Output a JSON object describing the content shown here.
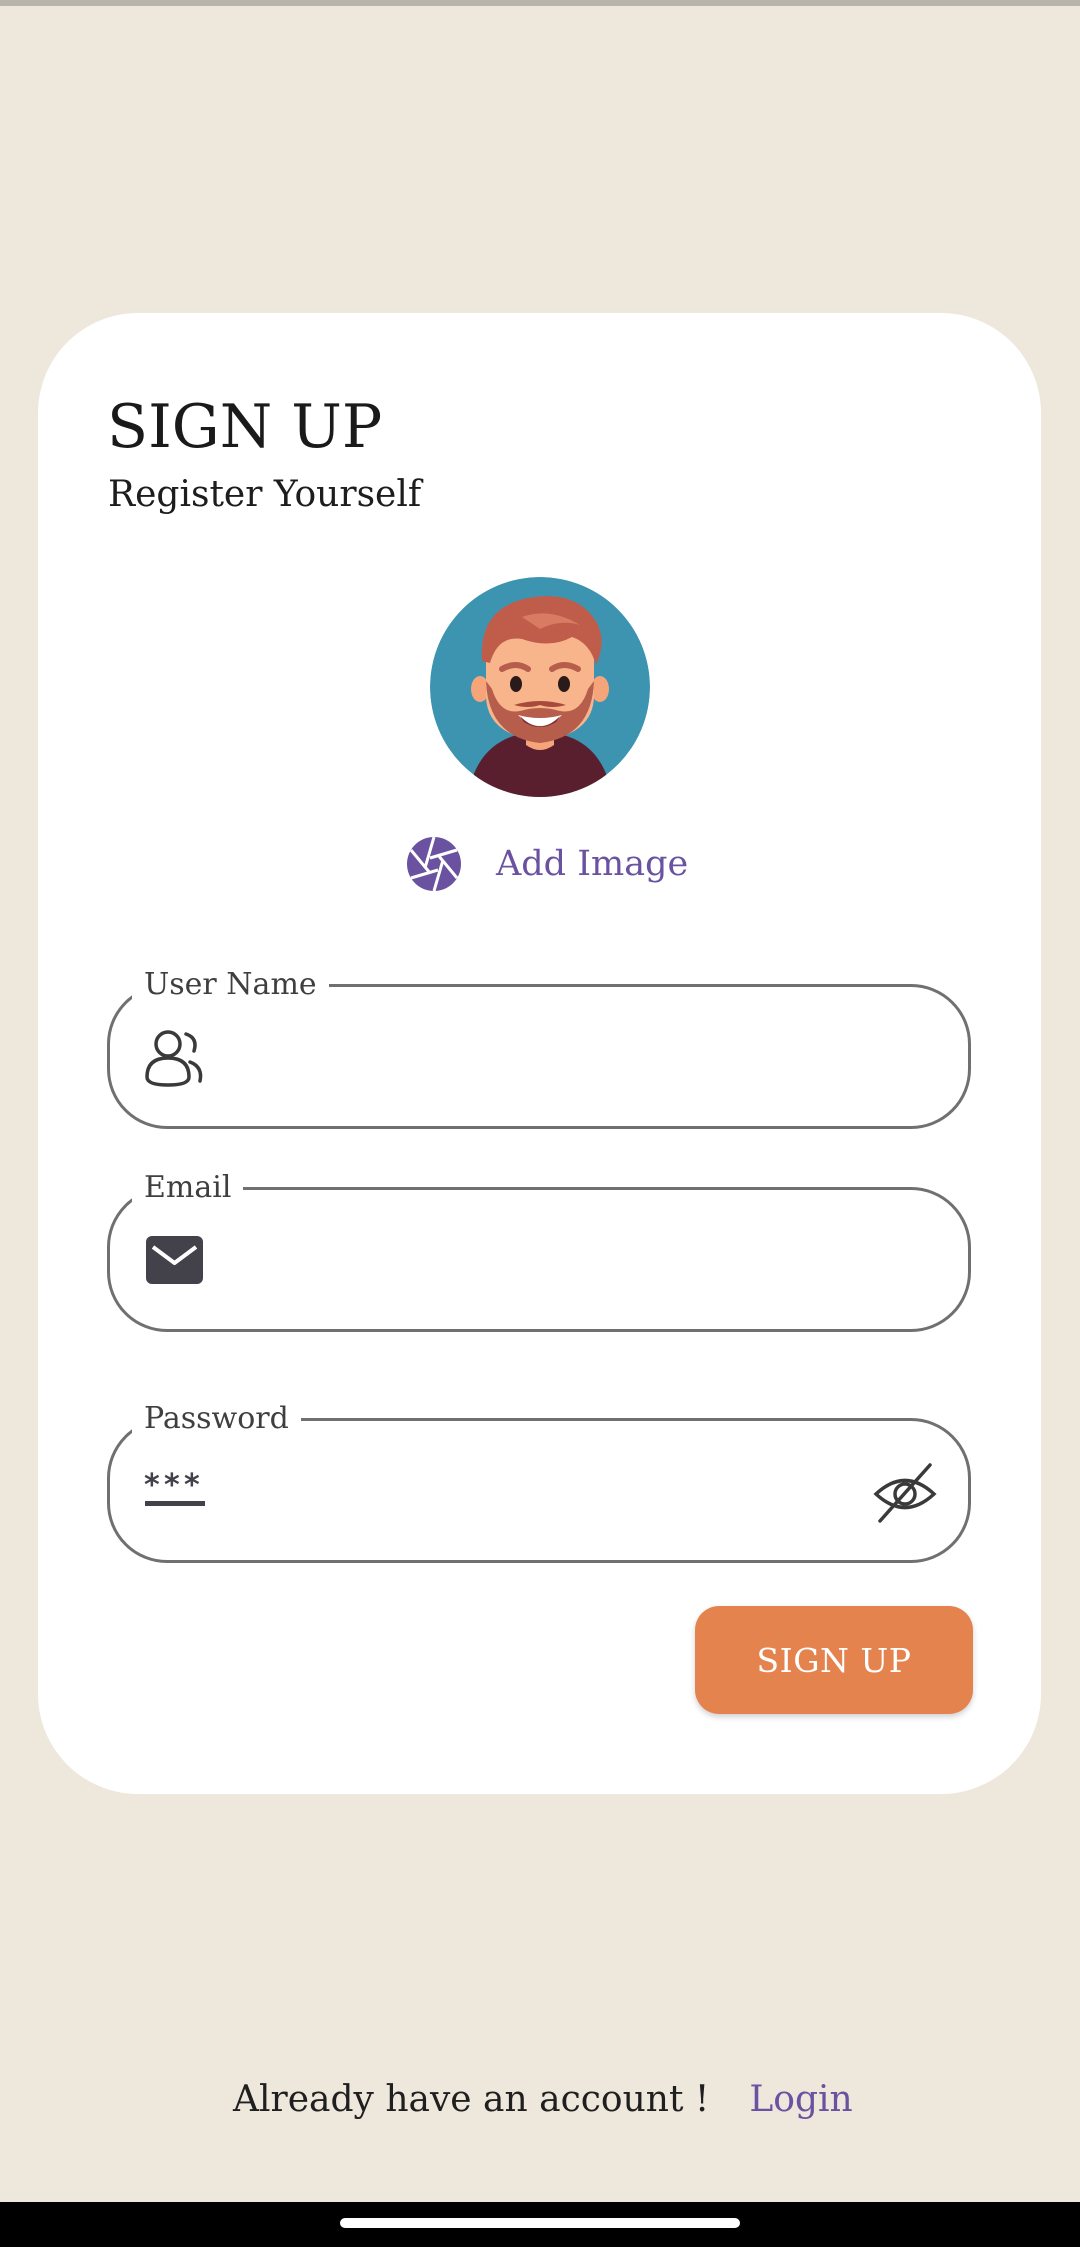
{
  "header": {
    "title": "SIGN UP",
    "subtitle": "Register Yourself"
  },
  "avatar": {
    "icon": "avatar-bearded-man",
    "add_image_label": "Add Image"
  },
  "form": {
    "username": {
      "label": "User Name",
      "value": "",
      "icon": "users-icon"
    },
    "email": {
      "label": "Email",
      "value": "",
      "icon": "envelope-icon"
    },
    "password": {
      "label": "Password",
      "value": "",
      "icon": "password-icon",
      "toggle_icon": "eye-off-icon"
    },
    "submit_label": "SIGN UP"
  },
  "footer": {
    "prompt": "Already have an account !",
    "login_label": "Login"
  },
  "colors": {
    "background": "#ede7dc",
    "card": "#ffffff",
    "accent": "#e5834f",
    "link": "#6a52a1",
    "border": "#707070"
  }
}
